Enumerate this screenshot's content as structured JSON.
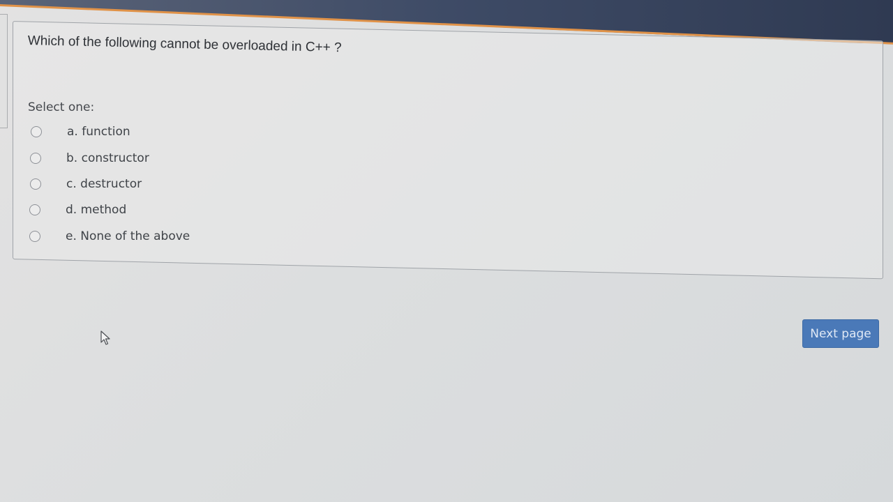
{
  "quiz": {
    "question": "Which of the following cannot be overloaded in C++ ?",
    "prompt": "Select one:",
    "options": [
      {
        "label": "a. function",
        "selected": false
      },
      {
        "label": "b. constructor",
        "selected": false
      },
      {
        "label": "c. destructor",
        "selected": false
      },
      {
        "label": "d. method",
        "selected": false
      },
      {
        "label": "e. None of the above",
        "selected": false
      }
    ]
  },
  "navigation": {
    "next_label": "Next page"
  },
  "colors": {
    "button_bg": "#4a79b8",
    "header_bg": "#3e4b66",
    "accent_line": "#e09248"
  },
  "icons": {
    "cursor": "mouse-pointer-icon",
    "radio": "radio-circle-icon"
  }
}
